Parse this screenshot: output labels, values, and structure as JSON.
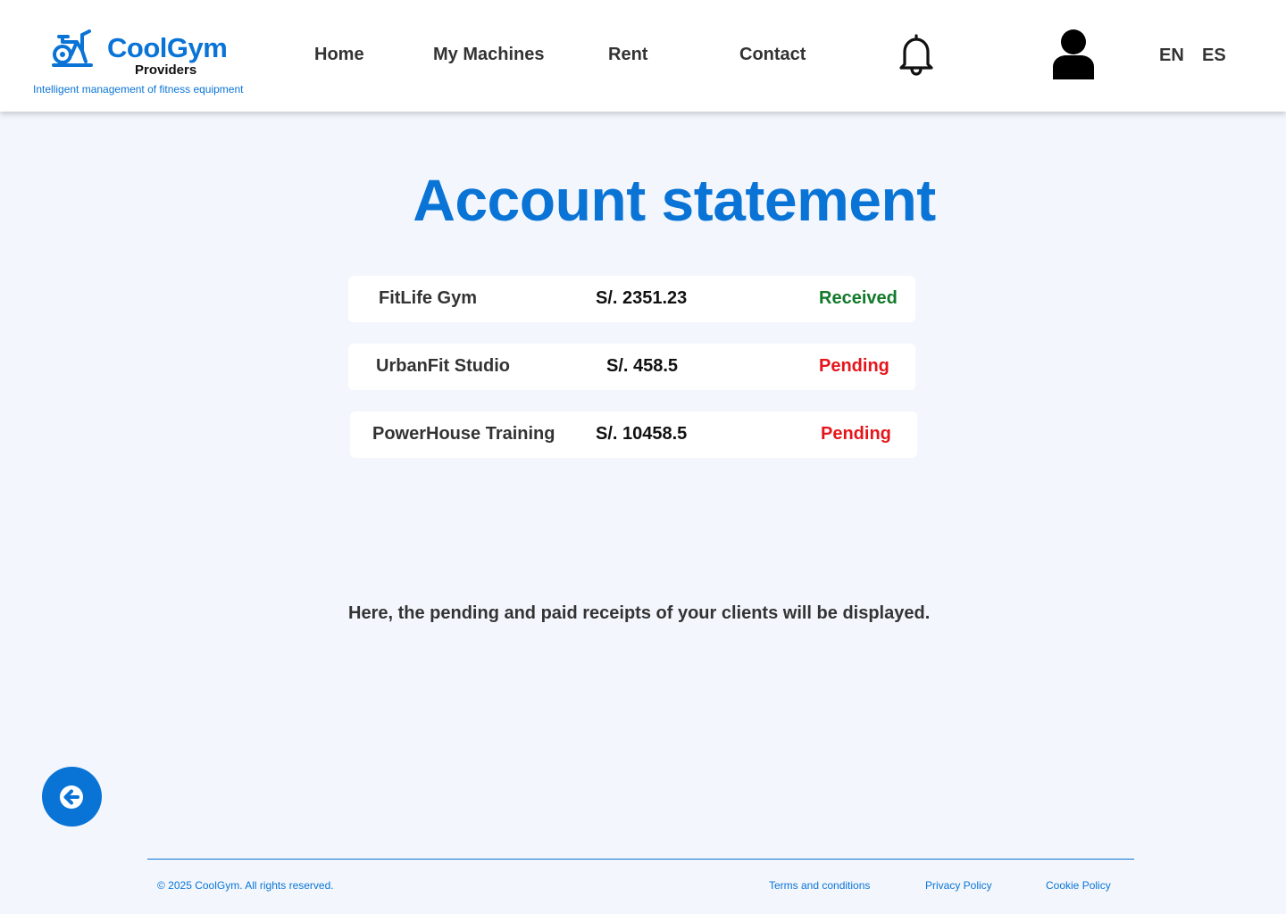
{
  "brand": {
    "name": "CoolGym",
    "subtitle": "Providers",
    "tagline": "Intelligent management of fitness equipment",
    "color": "#0a74d6"
  },
  "nav": {
    "home": "Home",
    "machines": "My Machines",
    "rent": "Rent",
    "contact": "Contact"
  },
  "header_icons": {
    "notifications": "bell-icon",
    "profile": "user-icon"
  },
  "languages": [
    "EN",
    "ES"
  ],
  "page": {
    "title": "Account statement",
    "info": "Here, the pending and paid receipts of your clients will be displayed."
  },
  "statements": [
    {
      "client": "FitLife Gym",
      "amount": "S/. 2351.23",
      "status": "Received"
    },
    {
      "client": "UrbanFit Studio",
      "amount": "S/. 458.5",
      "status": "Pending"
    },
    {
      "client": "PowerHouse Training",
      "amount": "S/. 10458.5",
      "status": "Pending"
    }
  ],
  "status_colors": {
    "received": "#127a2a",
    "pending": "#e5161b"
  },
  "back_button": {
    "icon": "arrow-left-icon"
  },
  "footer": {
    "copyright": "© 2025 CoolGym. All rights reserved.",
    "links": [
      "Terms and conditions",
      "Privacy Policy",
      "Cookie Policy"
    ]
  }
}
